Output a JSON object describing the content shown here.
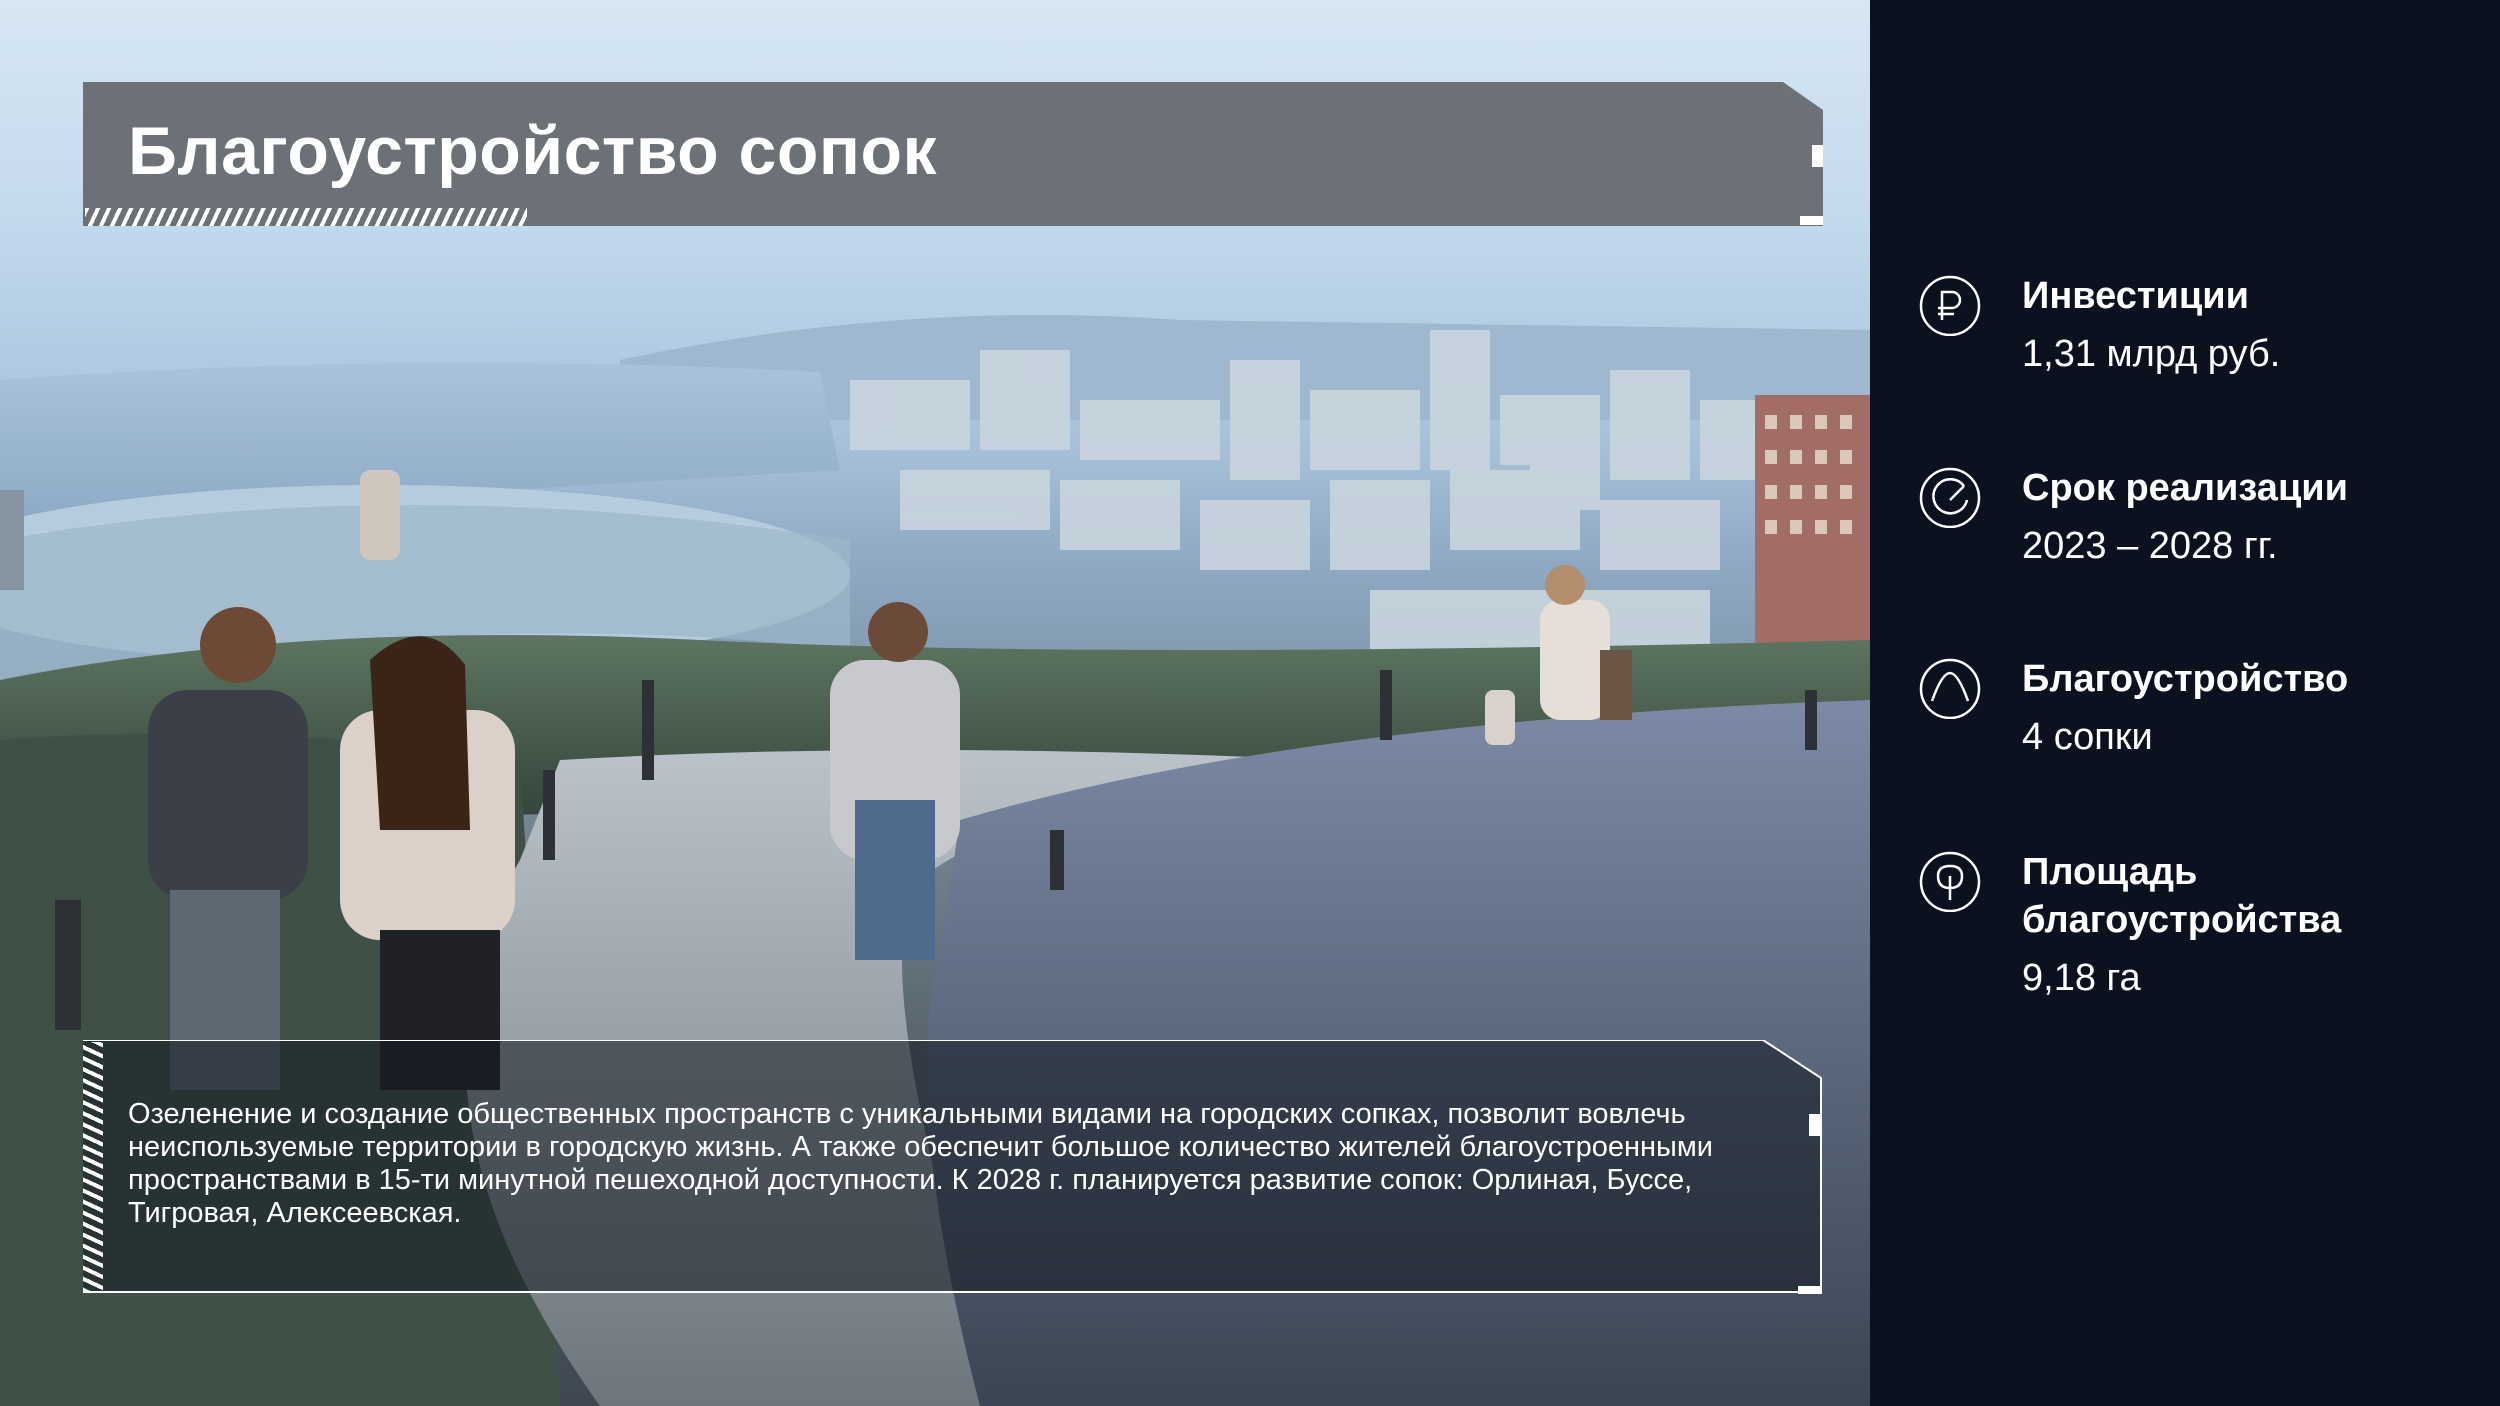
{
  "title": "Благоустройство сопок",
  "description": "Озеленение и создание общественных пространств с уникальными видами на городских сопках, позволит вовлечь неиспользуемые территории в городскую жизнь. А также обеспечит большое количество жителей благоустроенными пространствами в 15-ти минутной пешеходной доступности. К 2028 г. планируется развитие сопок: Орлиная, Буссе, Тигровая, Алексеевская.",
  "stats": [
    {
      "icon": "ruble-icon",
      "label": "Инвестиции",
      "value": "1,31 млрд руб."
    },
    {
      "icon": "clock-icon",
      "label": "Срок реализации",
      "value": "2023 – 2028 гг."
    },
    {
      "icon": "hill-icon",
      "label": "Благоустройство",
      "value": "4 сопки"
    },
    {
      "icon": "tree-icon",
      "label": "Площадь благоустройства",
      "value": "9,18 га"
    }
  ],
  "colors": {
    "panel": "#0c1120",
    "banner": "#666a70",
    "text": "#ffffff"
  }
}
